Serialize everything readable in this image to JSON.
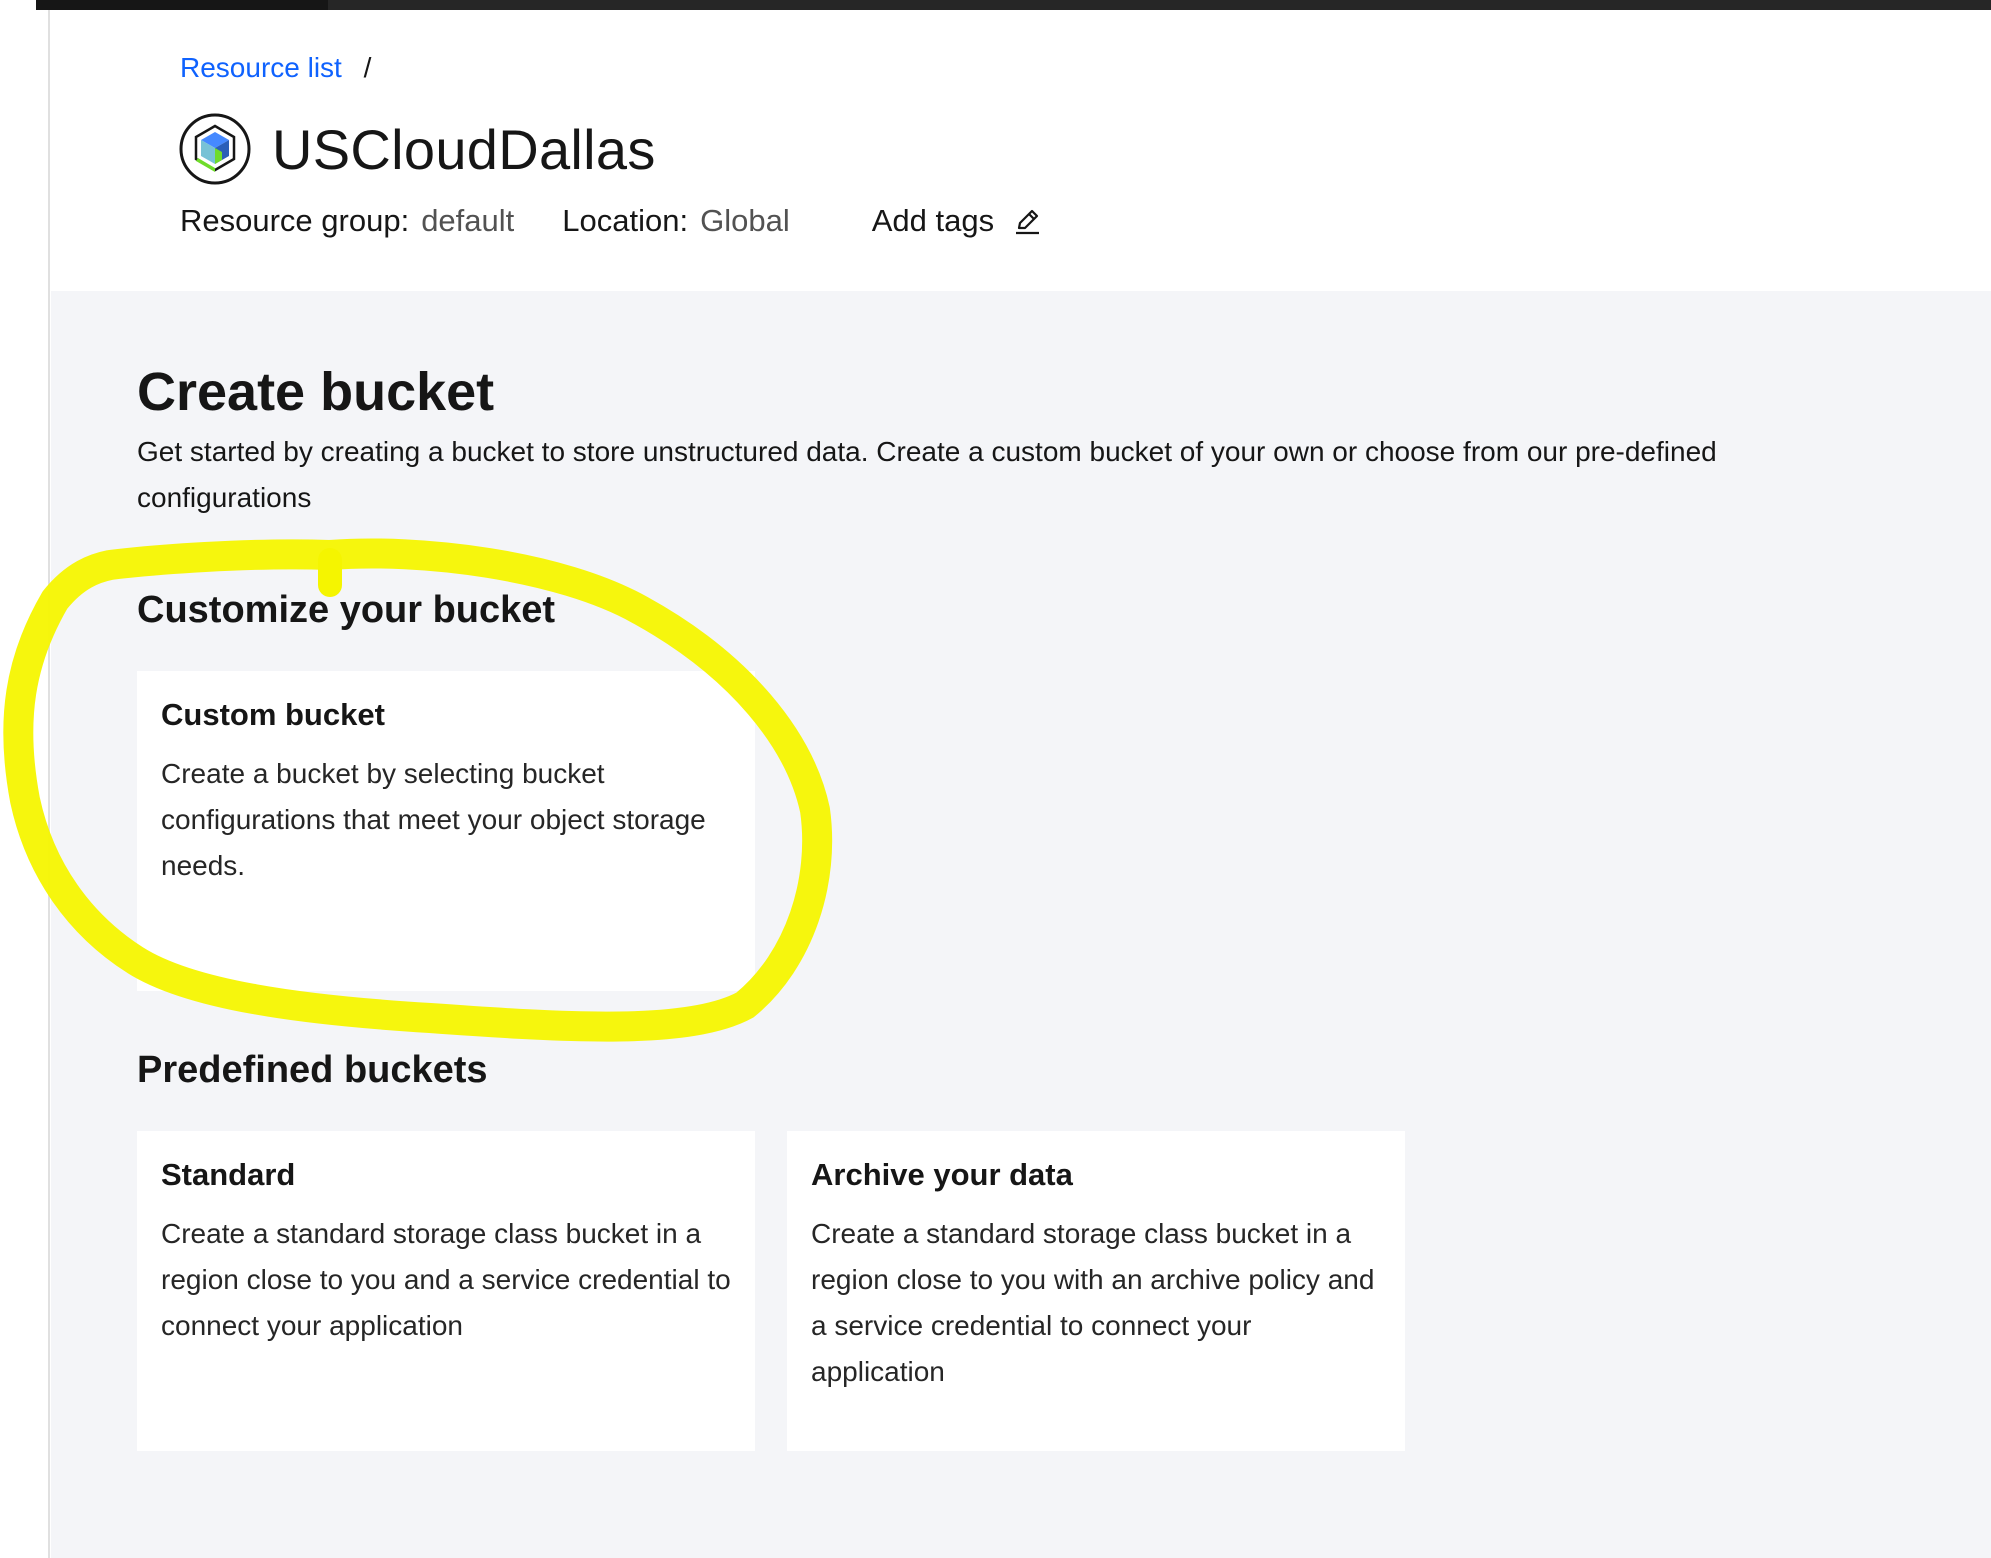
{
  "breadcrumb": {
    "link_label": "Resource list",
    "separator": "/"
  },
  "header": {
    "title": "USCloudDallas",
    "service_icon": "cube-icon",
    "resource_group_label": "Resource group:",
    "resource_group_value": "default",
    "location_label": "Location:",
    "location_value": "Global",
    "add_tags_label": "Add tags",
    "edit_icon": "pencil-icon"
  },
  "main": {
    "title": "Create bucket",
    "description": "Get started by creating a bucket to store unstructured data. Create a custom bucket of your own or choose from our pre-defined configurations",
    "customize_section": {
      "title": "Customize your bucket",
      "cards": [
        {
          "title": "Custom bucket",
          "description": "Create a bucket by selecting bucket configurations that meet your object storage needs."
        }
      ]
    },
    "predefined_section": {
      "title": "Predefined buckets",
      "cards": [
        {
          "title": "Standard",
          "description": "Create a standard storage class bucket in a region close to you and a service credential to connect your application"
        },
        {
          "title": "Archive your data",
          "description": "Create a standard storage class bucket in a region close to you with an archive policy and a service credential to connect your application"
        }
      ]
    }
  },
  "colors": {
    "link": "#0f62fe",
    "background": "#f4f5f8",
    "highlight": "#f5f500"
  }
}
